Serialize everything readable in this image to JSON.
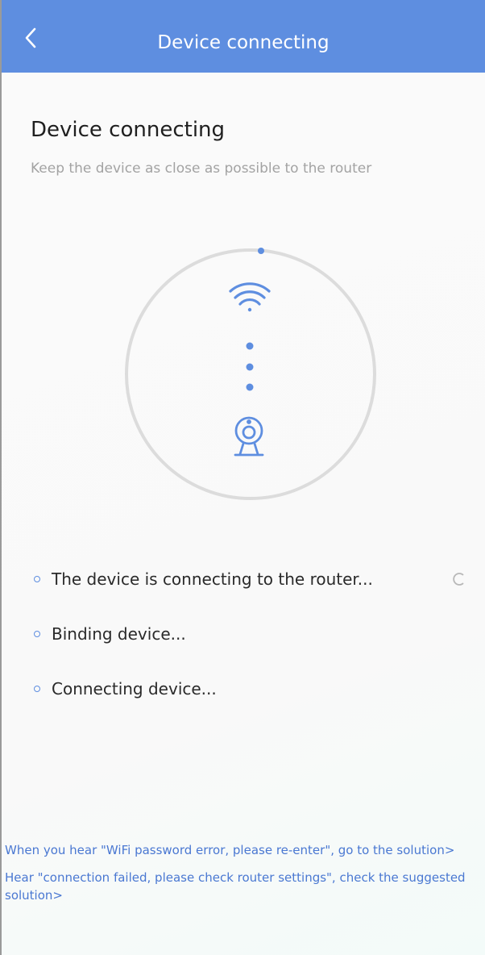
{
  "header": {
    "title": "Device connecting",
    "back_icon": "chevron-left-icon"
  },
  "content": {
    "title": "Device connecting",
    "subtitle": "Keep the device as close as possible to the router"
  },
  "graphic": {
    "icons": [
      "wifi-icon",
      "camera-icon"
    ],
    "accent_color": "#5e8ee0",
    "ring_color": "#dcdcdc"
  },
  "steps": [
    {
      "label": "The device is connecting to the router...",
      "status": "in-progress"
    },
    {
      "label": "Binding device...",
      "status": "pending"
    },
    {
      "label": "Connecting device...",
      "status": "pending"
    }
  ],
  "help_links": [
    {
      "text": "When you hear \"WiFi password error, please re-enter\", go to the solution>"
    },
    {
      "text": "Hear \"connection failed, please check router settings\", check the suggested solution>"
    }
  ],
  "colors": {
    "header_bg": "#5e8ee0",
    "link": "#4a78d2",
    "subtitle": "#a3a3a3"
  }
}
